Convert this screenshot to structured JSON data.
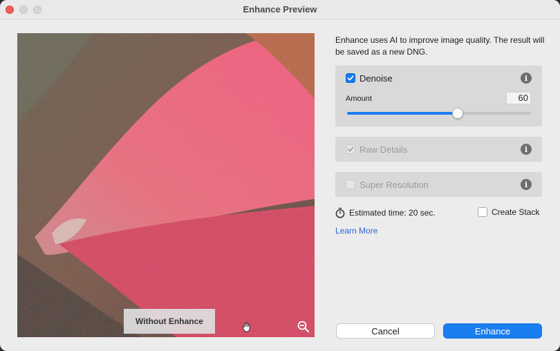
{
  "window": {
    "title": "Enhance Preview"
  },
  "preview": {
    "toggle_label": "Without Enhance",
    "hand_icon": "hand-pan-icon",
    "zoom_icon": "zoom-out-icon"
  },
  "description": "Enhance uses AI to improve image quality. The result will be saved as a new DNG.",
  "denoise": {
    "label": "Denoise",
    "checked": true,
    "amount_label": "Amount",
    "amount_value": "60",
    "amount_min": 0,
    "amount_max": 100
  },
  "raw_details": {
    "label": "Raw Details",
    "checked": true,
    "enabled": false
  },
  "super_resolution": {
    "label": "Super Resolution",
    "checked": false,
    "enabled": false
  },
  "estimate": {
    "text": "Estimated time: 20 sec."
  },
  "create_stack": {
    "label": "Create Stack",
    "checked": false
  },
  "learn_more": "Learn More",
  "buttons": {
    "cancel": "Cancel",
    "enhance": "Enhance"
  },
  "colors": {
    "accent": "#1a7ef0",
    "link": "#2c64d6",
    "close": "#ee5f57"
  }
}
